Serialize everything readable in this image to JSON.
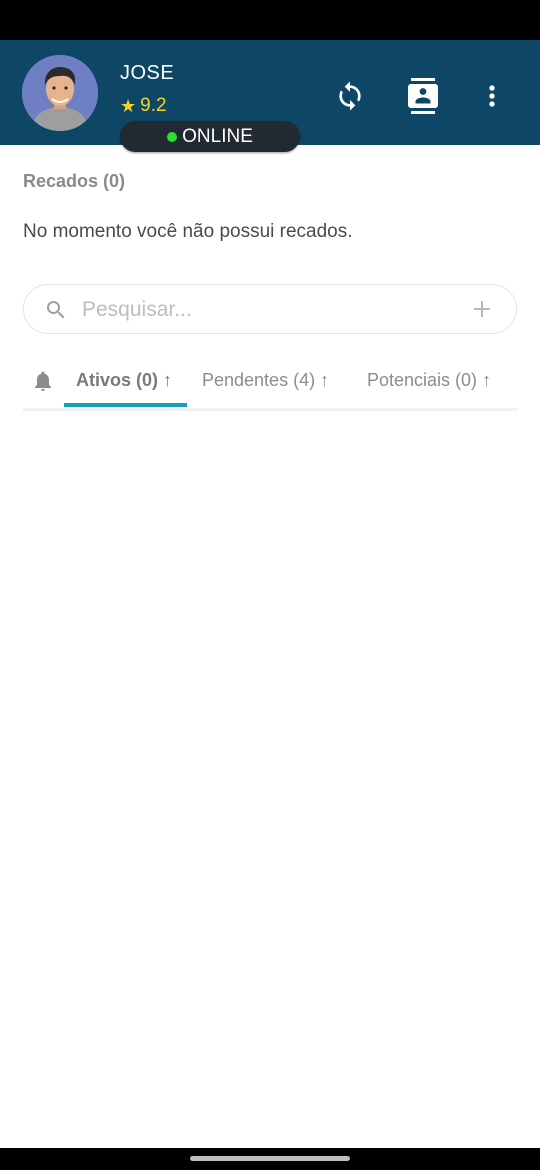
{
  "user": {
    "name": "JOSE",
    "rating": "9.2",
    "status": "ONLINE"
  },
  "colors": {
    "header_bg": "#0e4766",
    "accent": "#1b9db7",
    "online": "#2ee02e",
    "rating": "#f4d42c"
  },
  "header_icons": [
    "refresh-icon",
    "contacts-icon",
    "more-vert-icon"
  ],
  "messages": {
    "title": "Recados (0)",
    "empty_text": "No momento você não possui recados."
  },
  "search": {
    "placeholder": "Pesquisar...",
    "value": ""
  },
  "tabs": [
    {
      "label": "Ativos (0)",
      "arrow": "↑",
      "active": true
    },
    {
      "label": "Pendentes (4)",
      "arrow": "↑",
      "active": false
    },
    {
      "label": "Potenciais (0)",
      "arrow": "↑",
      "active": false
    }
  ]
}
